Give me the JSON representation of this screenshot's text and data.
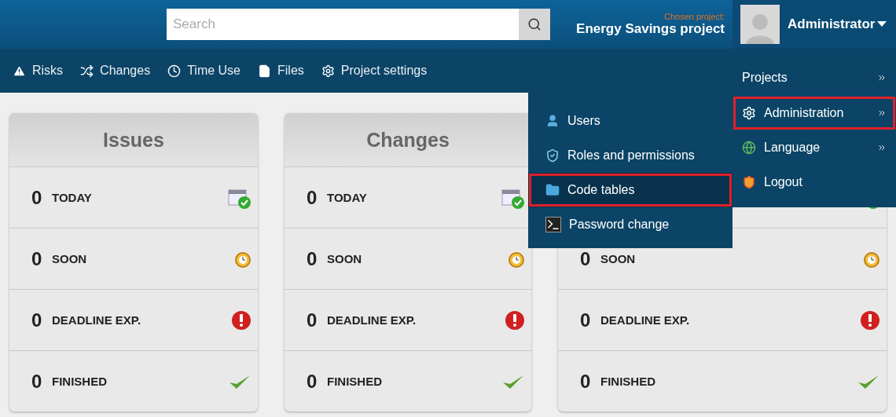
{
  "header": {
    "search": {
      "placeholder": "Search"
    },
    "project_caption": "Chosen project:",
    "project_name": "Energy Savings project",
    "user_name": "Administrator"
  },
  "nav": [
    {
      "kind": "risks",
      "label": "Risks"
    },
    {
      "kind": "changes",
      "label": "Changes"
    },
    {
      "kind": "time",
      "label": "Time Use"
    },
    {
      "kind": "files",
      "label": "Files"
    },
    {
      "kind": "settings",
      "label": "Project settings"
    }
  ],
  "user_menu": [
    {
      "kind": "projects",
      "label": "Projects",
      "submenu": true,
      "highlighted": false
    },
    {
      "kind": "admin",
      "label": "Administration",
      "submenu": true,
      "highlighted": true
    },
    {
      "kind": "language",
      "label": "Language",
      "submenu": true,
      "highlighted": false
    },
    {
      "kind": "logout",
      "label": "Logout",
      "submenu": false,
      "highlighted": false
    }
  ],
  "admin_submenu": [
    {
      "kind": "users",
      "label": "Users",
      "highlighted": false
    },
    {
      "kind": "roles",
      "label": "Roles and permissions",
      "highlighted": false
    },
    {
      "kind": "codes",
      "label": "Code tables",
      "highlighted": true
    },
    {
      "kind": "password",
      "label": "Password change",
      "highlighted": false
    }
  ],
  "cards": [
    {
      "title": "Issues",
      "rows": [
        {
          "kind": "today",
          "count": "0",
          "label": "TODAY"
        },
        {
          "kind": "soon",
          "count": "0",
          "label": "SOON"
        },
        {
          "kind": "expired",
          "count": "0",
          "label": "DEADLINE EXP."
        },
        {
          "kind": "finished",
          "count": "0",
          "label": "FINISHED"
        }
      ]
    },
    {
      "title": "Changes",
      "rows": [
        {
          "kind": "today",
          "count": "0",
          "label": "TODAY"
        },
        {
          "kind": "soon",
          "count": "0",
          "label": "SOON"
        },
        {
          "kind": "expired",
          "count": "0",
          "label": "DEADLINE EXP."
        },
        {
          "kind": "finished",
          "count": "0",
          "label": "FINISHED"
        }
      ]
    },
    {
      "rows": [
        {
          "kind": "today"
        },
        {
          "kind": "soon",
          "count": "0",
          "label": "SOON"
        },
        {
          "kind": "expired",
          "count": "0",
          "label": "DEADLINE EXP."
        },
        {
          "kind": "finished",
          "count": "0",
          "label": "FINISHED"
        }
      ]
    }
  ]
}
